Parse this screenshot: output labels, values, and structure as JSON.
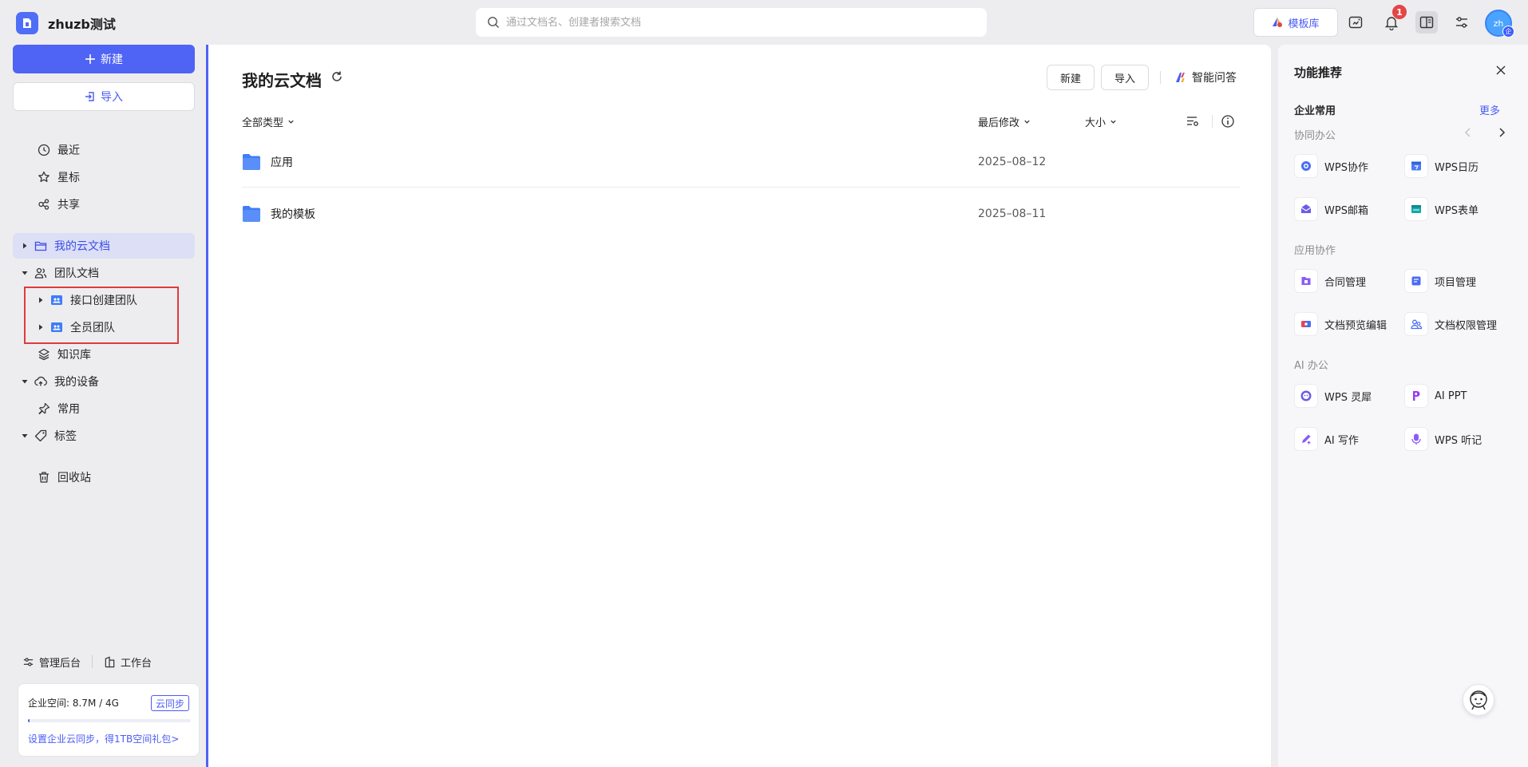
{
  "app": {
    "title": "zhuzb测试"
  },
  "search": {
    "placeholder": "通过文档名、创建者搜索文档"
  },
  "topbar": {
    "template_label": "模板库",
    "notification_count": "1",
    "avatar_text": "zh",
    "avatar_badge": "企"
  },
  "sidebar": {
    "new_label": "新建",
    "import_label": "导入",
    "items": [
      {
        "label": "最近"
      },
      {
        "label": "星标"
      },
      {
        "label": "共享"
      },
      {
        "label": "我的云文档"
      },
      {
        "label": "团队文档"
      },
      {
        "label": "接口创建团队"
      },
      {
        "label": "全员团队"
      },
      {
        "label": "知识库"
      },
      {
        "label": "我的设备"
      },
      {
        "label": "常用"
      },
      {
        "label": "标签"
      },
      {
        "label": "回收站"
      }
    ],
    "admin_label": "管理后台",
    "workbench_label": "工作台",
    "storage": {
      "label": "企业空间: 8.7M / 4G",
      "sync_label": "云同步",
      "used_fraction": 0.0021,
      "promo": "设置企业云同步，得1TB空间礼包>"
    }
  },
  "main": {
    "title": "我的云文档",
    "new_button": "新建",
    "import_button": "导入",
    "ai_label": "智能问答",
    "columns": {
      "type": "全部类型",
      "modified": "最后修改",
      "size": "大小"
    },
    "rows": [
      {
        "name": "应用",
        "modified": "2025–08–12"
      },
      {
        "name": "我的模板",
        "modified": "2025–08–11"
      }
    ]
  },
  "panel": {
    "title": "功能推荐",
    "section": "企业常用",
    "more": "更多",
    "groups": [
      {
        "label": "协同办公",
        "items": [
          "WPS协作",
          "WPS日历",
          "WPS邮箱",
          "WPS表单"
        ]
      },
      {
        "label": "应用协作",
        "items": [
          "合同管理",
          "项目管理",
          "文档预览编辑",
          "文档权限管理"
        ]
      },
      {
        "label": "AI 办公",
        "items": [
          "WPS 灵犀",
          "AI PPT",
          "AI 写作",
          "WPS 听记"
        ]
      }
    ]
  },
  "colors": {
    "accent": "#4f63f5",
    "highlight_box": "#e23a3a",
    "folder": "#3f7cf7"
  }
}
